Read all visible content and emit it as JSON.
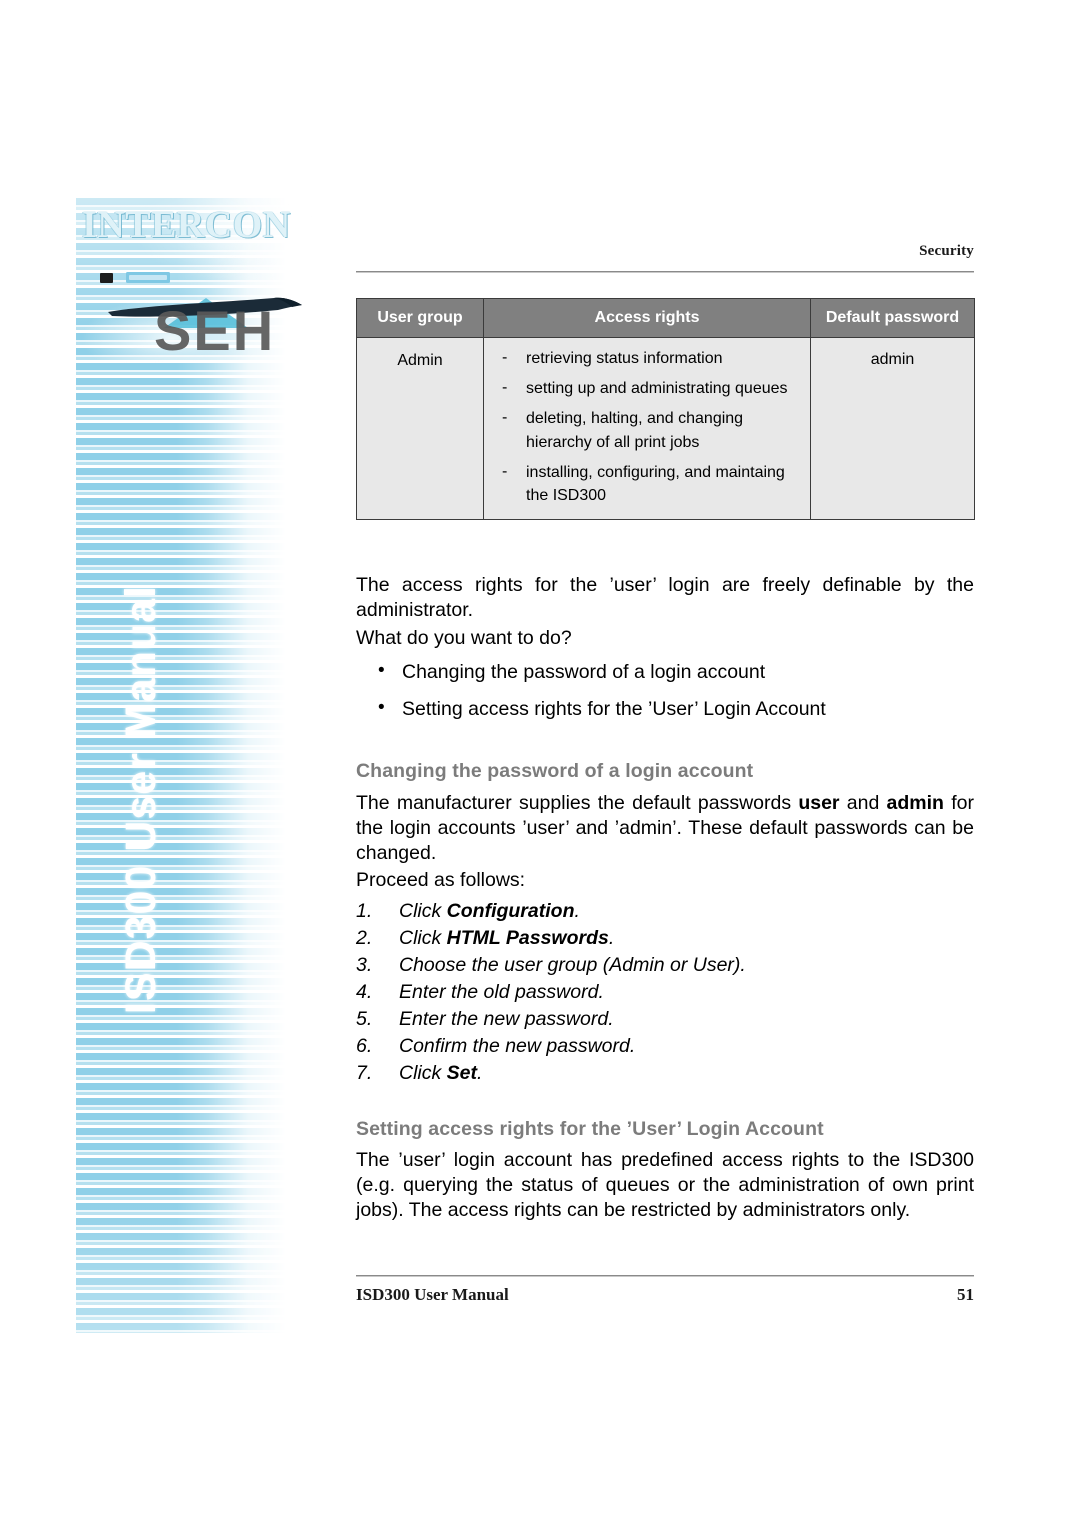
{
  "sidebar": {
    "logo_primary": "INTERCON",
    "logo_secondary": "SEH",
    "vertical_title": "ISD300 User Manual"
  },
  "header": {
    "running_head": "Security"
  },
  "table": {
    "columns": [
      "User group",
      "Access rights",
      "Default password"
    ],
    "rows": [
      {
        "user_group": "Admin",
        "access_rights": [
          "retrieving status information",
          "setting up and administrating queues",
          "deleting, halting, and changing hierarchy of all print jobs",
          "installing, configuring, and maintaing the ISD300"
        ],
        "default_password": "admin"
      }
    ],
    "dash_marker": "-"
  },
  "body": {
    "intro_paragraph": "The access rights for the ’user’ login are freely definable by the administrator.",
    "what_do_you_want": "What do you want to do?",
    "bullets": [
      "Changing the password of a login account",
      "Setting access rights for the ’User’ Login Account"
    ],
    "bullet_marker": "•"
  },
  "section1": {
    "heading": "Changing the password of a login account",
    "paragraph_part1": "The manufacturer supplies the default passwords ",
    "paragraph_bold1": "user",
    "paragraph_part2": " and ",
    "paragraph_bold2": "admin",
    "paragraph_part3": " for the login accounts ’user’ and ’admin’. These default passwords can be changed.",
    "proceed_label": "Proceed as follows:",
    "steps": [
      {
        "num": "1.",
        "text_before": "Click ",
        "bold": "Configuration",
        "text_after": "."
      },
      {
        "num": "2.",
        "text_before": "Click ",
        "bold": "HTML Passwords",
        "text_after": "."
      },
      {
        "num": "3.",
        "text_before": "Choose the user group (Admin or User).",
        "bold": "",
        "text_after": ""
      },
      {
        "num": "4.",
        "text_before": "Enter the old password.",
        "bold": "",
        "text_after": ""
      },
      {
        "num": "5.",
        "text_before": "Enter the new password.",
        "bold": "",
        "text_after": ""
      },
      {
        "num": "6.",
        "text_before": "Confirm the new password.",
        "bold": "",
        "text_after": ""
      },
      {
        "num": "7.",
        "text_before": "Click ",
        "bold": "Set",
        "text_after": "."
      }
    ]
  },
  "section2": {
    "heading": "Setting access rights for the ’User’ Login Account",
    "paragraph": "The ’user’ login account has predefined access rights to the ISD300 (e.g. querying the status of queues or the administration of own print jobs). The access rights can be restricted by administrators only."
  },
  "footer": {
    "left": "ISD300 User Manual",
    "page_number": "51"
  },
  "colors": {
    "table_header_bg": "#808080",
    "table_cell_bg": "#e8e8e8",
    "heading_gray": "#7c7c7c",
    "sidebar_blue": "#8fd0e8",
    "rule_gray": "#8a8a8a"
  }
}
